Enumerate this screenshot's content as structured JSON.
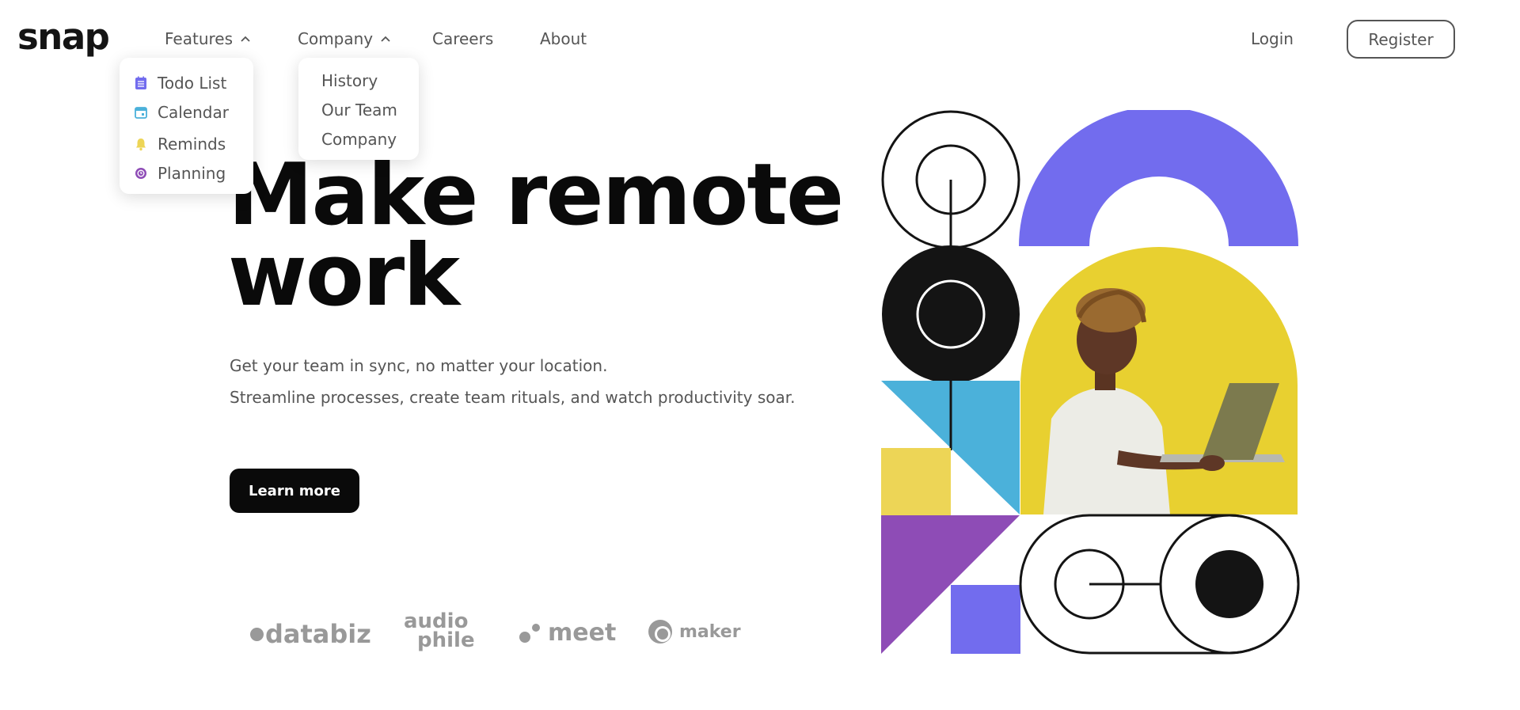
{
  "brand": {
    "logo": "snap"
  },
  "nav": {
    "features": "Features",
    "company": "Company",
    "careers": "Careers",
    "about": "About",
    "login": "Login",
    "register": "Register"
  },
  "features_menu": [
    {
      "label": "Todo List",
      "icon": "todo-icon",
      "color": "#726CEE"
    },
    {
      "label": "Calendar",
      "icon": "calendar-icon",
      "color": "#4BB1DA"
    },
    {
      "label": "Reminds",
      "icon": "bell-icon",
      "color": "#EDD556"
    },
    {
      "label": "Planning",
      "icon": "planning-icon",
      "color": "#8E4CB6"
    }
  ],
  "company_menu": [
    "History",
    "Our Team",
    "Company"
  ],
  "hero": {
    "title_line1": "Make remote",
    "title_line2": "work",
    "subtitle_line1": "Get your team in sync, no matter your location.",
    "subtitle_line2": "Streamline processes, create team rituals, and watch productivity soar.",
    "cta": "Learn more"
  },
  "clients": {
    "databiz": "databiz",
    "audiophile_line1": "audio",
    "audiophile_line2": "phile",
    "meet": "meet",
    "maker": "maker"
  },
  "colors": {
    "purple": "#726CEE",
    "yellow": "#EDD556",
    "blue": "#4BB1DA",
    "violet": "#8E4CB6",
    "black": "#141414"
  }
}
